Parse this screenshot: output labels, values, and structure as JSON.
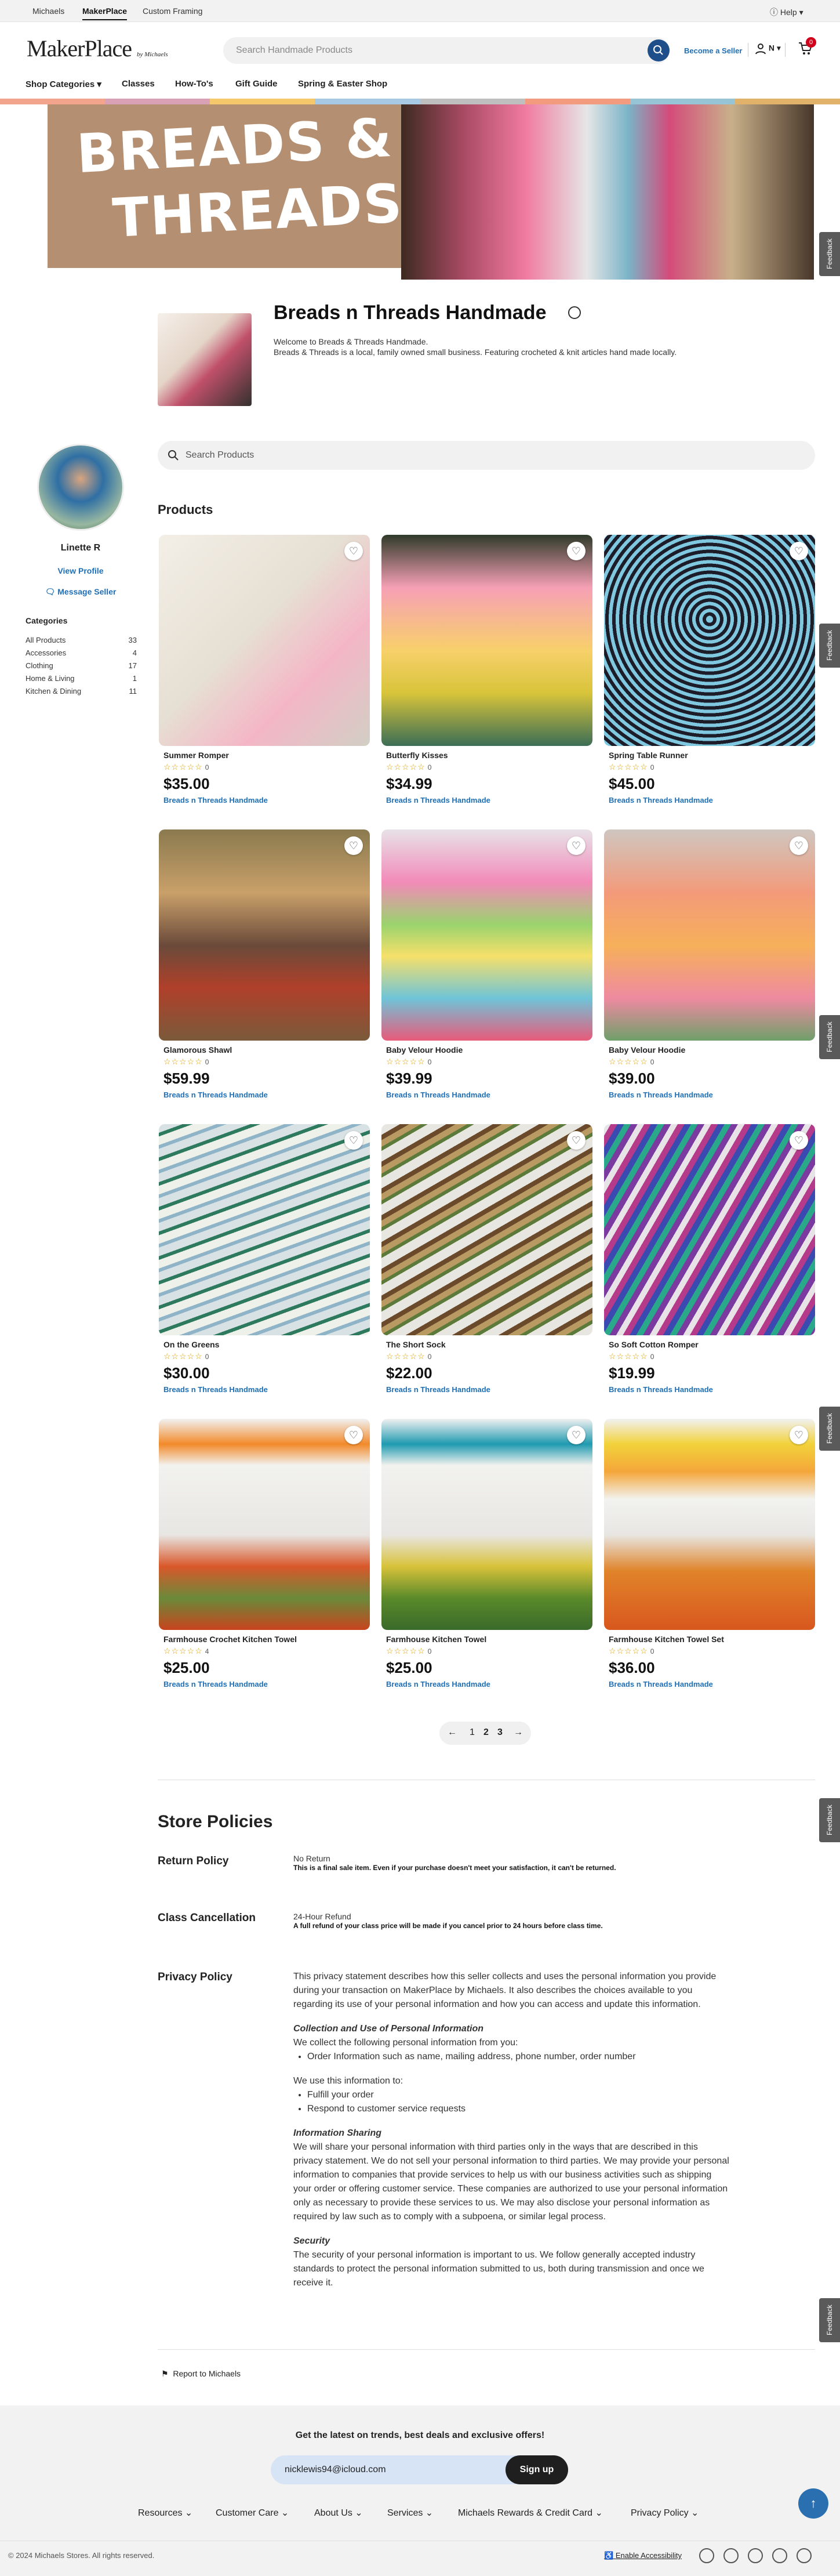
{
  "topbar": {
    "links": [
      "Michaels",
      "MakerPlace",
      "Custom Framing"
    ],
    "help": "Help"
  },
  "header": {
    "logo": "MakerPlace",
    "logo_sub": "by Michaels",
    "search_placeholder": "Search Handmade Products",
    "become_seller": "Become a Seller",
    "user_initial": "N",
    "cart_count": "0"
  },
  "nav": {
    "items": [
      "Shop Categories",
      "Classes",
      "How-To's",
      "Gift Guide",
      "Spring & Easter Shop"
    ]
  },
  "banner": {
    "line1": "BREADS &",
    "line2": "THREADS"
  },
  "store": {
    "title": "Breads n Threads Handmade",
    "welcome": "Welcome to Breads & Threads Handmade.",
    "description": "Breads & Threads is a local, family owned small business. Featuring crocheted & knit articles hand made locally."
  },
  "product_search": {
    "placeholder": "Search Products"
  },
  "seller": {
    "name": "Linette R",
    "view_profile": "View Profile",
    "message": "Message Seller"
  },
  "categories": {
    "heading": "Categories",
    "items": [
      {
        "name": "All Products",
        "count": "33"
      },
      {
        "name": "Accessories",
        "count": "4"
      },
      {
        "name": "Clothing",
        "count": "17"
      },
      {
        "name": "Home & Living",
        "count": "1"
      },
      {
        "name": "Kitchen & Dining",
        "count": "11"
      }
    ]
  },
  "products": {
    "heading": "Products",
    "items": [
      {
        "name": "Summer Romper",
        "rating_count": "0",
        "price": "$35.00",
        "seller": "Breads n Threads Handmade"
      },
      {
        "name": "Butterfly Kisses",
        "rating_count": "0",
        "price": "$34.99",
        "seller": "Breads n Threads Handmade"
      },
      {
        "name": "Spring Table Runner",
        "rating_count": "0",
        "price": "$45.00",
        "seller": "Breads n Threads Handmade"
      },
      {
        "name": "Glamorous Shawl",
        "rating_count": "0",
        "price": "$59.99",
        "seller": "Breads n Threads Handmade"
      },
      {
        "name": "Baby Velour Hoodie",
        "rating_count": "0",
        "price": "$39.99",
        "seller": "Breads n Threads Handmade"
      },
      {
        "name": "Baby Velour Hoodie",
        "rating_count": "0",
        "price": "$39.00",
        "seller": "Breads n Threads Handmade"
      },
      {
        "name": "On the Greens",
        "rating_count": "0",
        "price": "$30.00",
        "seller": "Breads n Threads Handmade"
      },
      {
        "name": "The Short Sock",
        "rating_count": "0",
        "price": "$22.00",
        "seller": "Breads n Threads Handmade"
      },
      {
        "name": "So Soft Cotton Romper",
        "rating_count": "0",
        "price": "$19.99",
        "seller": "Breads n Threads Handmade"
      },
      {
        "name": "Farmhouse Crochet Kitchen Towel",
        "rating_count": "4",
        "price": "$25.00",
        "seller": "Breads n Threads Handmade"
      },
      {
        "name": "Farmhouse Kitchen Towel",
        "rating_count": "0",
        "price": "$25.00",
        "seller": "Breads n Threads Handmade"
      },
      {
        "name": "Farmhouse Kitchen Towel Set",
        "rating_count": "0",
        "price": "$36.00",
        "seller": "Breads n Threads Handmade"
      }
    ]
  },
  "pagination": {
    "pages": [
      "1",
      "2",
      "3"
    ]
  },
  "policies": {
    "heading": "Store Policies",
    "return_h": "Return Policy",
    "return_title": "No Return",
    "return_text": "This is a final sale item. Even if your purchase doesn't meet your satisfaction, it can't be returned.",
    "class_h": "Class Cancellation",
    "class_title": "24-Hour Refund",
    "class_text": "A full refund of your class price will be made if you cancel prior to 24 hours before class time.",
    "privacy_h": "Privacy Policy",
    "privacy_intro": "This privacy statement describes how this seller collects and uses the personal information you provide during your transaction on MakerPlace by Michaels. It also describes the choices available to you regarding its use of your personal information and how you can access and update this information.",
    "collection_h": "Collection and Use of Personal Information",
    "collection_text": "We collect the following personal information from you:",
    "collection_li": "Order Information such as name, mailing address, phone number, order number",
    "use_text": "We use this information to:",
    "use_li1": "Fulfill your order",
    "use_li2": "Respond to customer service requests",
    "sharing_h": "Information Sharing",
    "sharing_text": "We will share your personal information with third parties only in the ways that are described in this privacy statement. We do not sell your personal information to third parties. We may provide your personal information to companies that provide services to help us with our business activities such as shipping your order or offering customer service. These companies are authorized to use your personal information only as necessary to provide these services to us. We may also disclose your personal information as required by law such as to comply with a subpoena, or similar legal process.",
    "security_h": "Security",
    "security_text": "The security of your personal information is important to us. We follow generally accepted industry standards to protect the personal information submitted to us, both during transmission and once we receive it."
  },
  "report": "Report to Michaels",
  "feedback_label": "Feedback",
  "footer": {
    "newsletter": "Get the latest on trends, best deals and exclusive offers!",
    "email": "nicklewis94@icloud.com",
    "signup": "Sign up",
    "links": [
      "Resources",
      "Customer Care",
      "About Us",
      "Services",
      "Michaels Rewards & Credit Card",
      "Privacy Policy"
    ],
    "copyright": "© 2024 Michaels Stores. All rights reserved.",
    "accessibility": "Enable Accessibility"
  },
  "colors": {
    "accent": "#1f6fb5",
    "brand_navy": "#1f4f8a",
    "star": "#d8a100",
    "cart_badge": "#d0021b"
  }
}
